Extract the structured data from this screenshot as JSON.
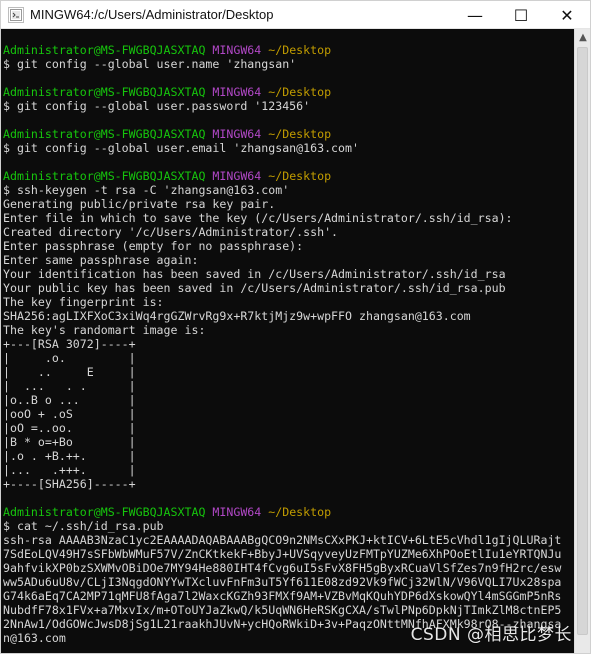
{
  "window": {
    "title": "MINGW64:/c/Users/Administrator/Desktop",
    "controls": {
      "minimize": "—",
      "maximize": "☐",
      "close": "✕"
    },
    "icons": {
      "app": "terminal-icon",
      "minimize": "minimize-icon",
      "maximize": "maximize-icon",
      "close": "close-icon"
    }
  },
  "colors": {
    "background": "#0c0c0c",
    "foreground": "#d6d6d6",
    "prompt_user": "#16c60c",
    "prompt_mingw": "#b148c6",
    "prompt_path": "#c19c00"
  },
  "terminal": {
    "prompt": {
      "user_host": "Administrator@MS-FWGBQJASXTAQ",
      "shell": "MINGW64",
      "path": "~/Desktop"
    },
    "blocks": [
      {
        "command": "$ git config --global user.name 'zhangsan'",
        "output": []
      },
      {
        "command": "$ git config --global user.password '123456'",
        "output": []
      },
      {
        "command": "$ git config --global user.email 'zhangsan@163.com'",
        "output": []
      },
      {
        "command": "$ ssh-keygen -t rsa -C 'zhangsan@163.com'",
        "output": [
          "Generating public/private rsa key pair.",
          "Enter file in which to save the key (/c/Users/Administrator/.ssh/id_rsa):",
          "Created directory '/c/Users/Administrator/.ssh'.",
          "Enter passphrase (empty for no passphrase):",
          "Enter same passphrase again:",
          "Your identification has been saved in /c/Users/Administrator/.ssh/id_rsa",
          "Your public key has been saved in /c/Users/Administrator/.ssh/id_rsa.pub",
          "The key fingerprint is:",
          "SHA256:agLIXFXoC3xiWq4rgGZWrvRg9x+R7ktjMjz9w+wpFFO zhangsan@163.com",
          "The key's randomart image is:",
          "+---[RSA 3072]----+",
          "|     .o.         |",
          "|    ..     E     |",
          "|  ...   . .      |",
          "|o..B o ...       |",
          "|ooO + .oS        |",
          "|oO =..oo.        |",
          "|B * o=+Bo        |",
          "|.o . +B.++.      |",
          "|...   .+++.      |",
          "+----[SHA256]-----+"
        ]
      },
      {
        "command": "$ cat ~/.ssh/id_rsa.pub",
        "output": [
          "ssh-rsa AAAAB3NzaC1yc2EAAAADAQABAAABgQCO9n2NMsCXxPKJ+ktICV+6LtE5cVhdl1gIjQLURajt",
          "7SdEoLQV49H7sSFbWbWMuF57V/ZnCKtkekF+BbyJ+UVSqyveyUzFMTpYUZMe6XhPOoEtlIu1eYRTQNJu",
          "9ahfvikXP0bzSXWMvOBiDOe7MY94He880IHT4fCvg6uI5sFvX8FH5gByxRCuaVlSfZes7n9fH2rc/esw",
          "ww5ADu6uU8v/CLjI3NqgdONYYwTXcluvFnFm3uT5Yf611E08zd92Vk9fWCj32WlN/V96VQLI7Ux28spa",
          "G74k6aEq7CA2MP71qMFU8fAga7l2WaxcKGZh93FMXf9AM+VZBvMqKQuhYDP6dXskowQYl4mSGGmP5nRs",
          "NubdfF78x1FVx+a7MxvIx/m+OToUYJaZkwQ/k5UqWN6HeRSKgCXA/sTwlPNp6DpkNjTImkZlM8ctnEP5",
          "2NnAw1/OdGOWcJwsD8jSg1L21raakhJUvN+ycHQoRWkiD+3v+PaqzONttMNfhAFXMk98rO8--zhangsa",
          "n@163.com"
        ]
      }
    ]
  },
  "watermark": "CSDN @相思比梦长"
}
